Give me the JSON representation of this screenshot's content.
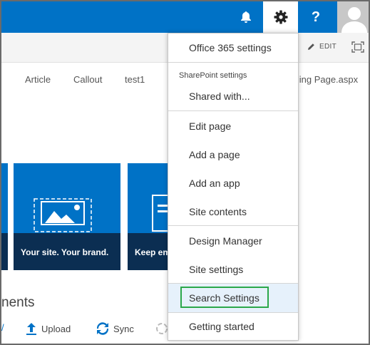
{
  "suite_bar": {
    "bell_icon": "bell-icon",
    "gear_icon": "gear-icon",
    "help_label": "?",
    "avatar_icon": "user-avatar-icon",
    "accent_color": "#0072c6"
  },
  "ribbon": {
    "edit_label": "EDIT",
    "edit_icon": "pencil-icon",
    "focus_icon": "focus-on-content-icon"
  },
  "page_tabs": [
    "Article",
    "Callout",
    "test1"
  ],
  "partial_tab_text": "shing Page.aspx",
  "tiles": {
    "main_caption": "Your site. Your brand.",
    "third_caption": "Keep em"
  },
  "section": {
    "heading": "nents"
  },
  "commands": {
    "upload": "Upload",
    "sync": "Sync"
  },
  "menu": {
    "office_365_settings": "Office 365 settings",
    "sharepoint_section": "SharePoint settings",
    "shared_with": "Shared with...",
    "edit_page": "Edit page",
    "add_a_page": "Add a page",
    "add_an_app": "Add an app",
    "site_contents": "Site contents",
    "design_manager": "Design Manager",
    "site_settings": "Site settings",
    "search_settings": "Search Settings",
    "getting_started": "Getting started",
    "highlight_color": "#2ba84a"
  }
}
